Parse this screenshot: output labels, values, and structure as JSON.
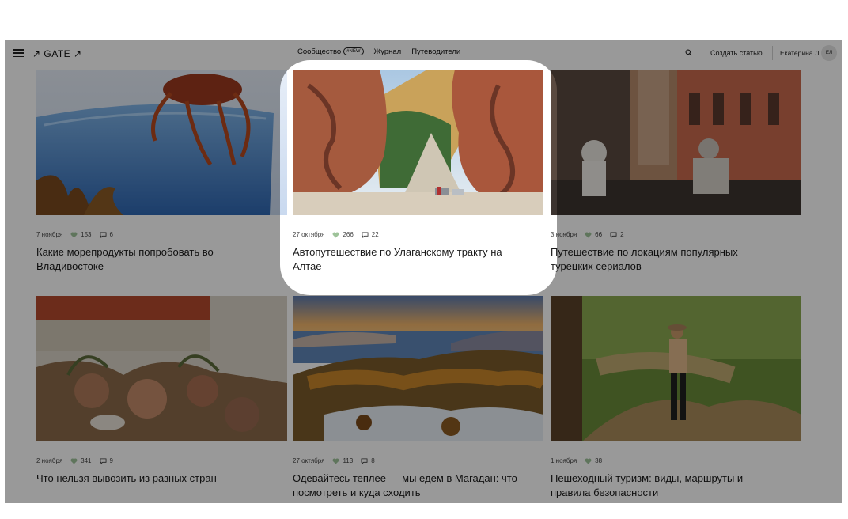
{
  "header": {
    "logo": "↗ GATE ↗",
    "nav": [
      {
        "label": "Сообщество",
        "badge": "#NEW"
      },
      {
        "label": "Журнал"
      },
      {
        "label": "Путеводители"
      }
    ],
    "create_label": "Создать статью",
    "user_name": "Екатерина Л.",
    "avatar_initials": "ЕЛ"
  },
  "cards": [
    {
      "date": "7 ноября",
      "likes": "153",
      "comments": "6",
      "title": "Какие морепродукты попробовать во Владивостоке",
      "image": "crab-in-glass"
    },
    {
      "date": "27 октября",
      "likes": "266",
      "comments": "22",
      "title": "Автопутешествие по Улаганскому тракту на Алтае",
      "image": "canyon-road"
    },
    {
      "date": "3 ноября",
      "likes": "66",
      "comments": "2",
      "title": "Путешествие по локациям популярных турецких сериалов",
      "image": "istanbul-street"
    },
    {
      "date": "2 ноября",
      "likes": "341",
      "comments": "9",
      "title": "Что нельзя вывозить из разных стран",
      "image": "dried-flowers"
    },
    {
      "date": "27 октября",
      "likes": "113",
      "comments": "8",
      "title": "Одевайтесь теплее — мы едем в Магадан: что посмотреть и куда сходить",
      "image": "magadan-coast"
    },
    {
      "date": "1 ноября",
      "likes": "38",
      "comments": "",
      "title": "Пешеходный туризм: виды, маршруты и правила безопасности",
      "image": "hiker-forest"
    }
  ],
  "colors": {
    "dim_overlay": "#000000",
    "heart_icon": "#9ec39a",
    "text": "#1a1a1a"
  }
}
